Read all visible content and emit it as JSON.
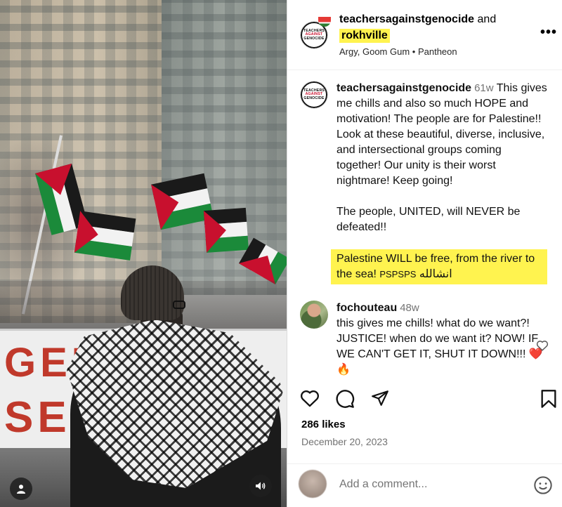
{
  "media": {
    "banner_line1": "GENO  N G",
    "banner_line2": "SE     O"
  },
  "header": {
    "author": "teachersagainstgenocide",
    "and": "and",
    "coauthor": "rokhville",
    "audio": "Argy, Goom Gum • Pantheon",
    "more": "•••",
    "logo_line1": "TEACHERS",
    "logo_line2": "AGAINST",
    "logo_line3": "GENOCIDE"
  },
  "comments": [
    {
      "username": "teachersagainstgenocide",
      "time": "61w",
      "para1": "This gives me chills and also so much HOPE and motivation! The people are for Palestine!! Look at these beautiful, diverse, inclusive, and intersectional groups coming together! Our unity is their worst nightmare! Keep going!",
      "para2": "The people, UNITED, will NEVER be defeated!!",
      "para3_main": "Palestine WILL be free, from the river to the sea!",
      "para3_small": "PSPSPS",
      "para3_arabic": "انشالله"
    },
    {
      "username": "fochouteau",
      "time": "48w",
      "text": "this gives me chills! what do we want?! JUSTICE! when do we want it? NOW! IF WE CAN'T GET IT, SHUT IT DOWN!!! ❤️🔥"
    }
  ],
  "likes": "286 likes",
  "date": "December 20, 2023",
  "add_comment_placeholder": "Add a comment...",
  "colors": {
    "highlight": "#fff34f",
    "secondary_text": "#737373"
  }
}
